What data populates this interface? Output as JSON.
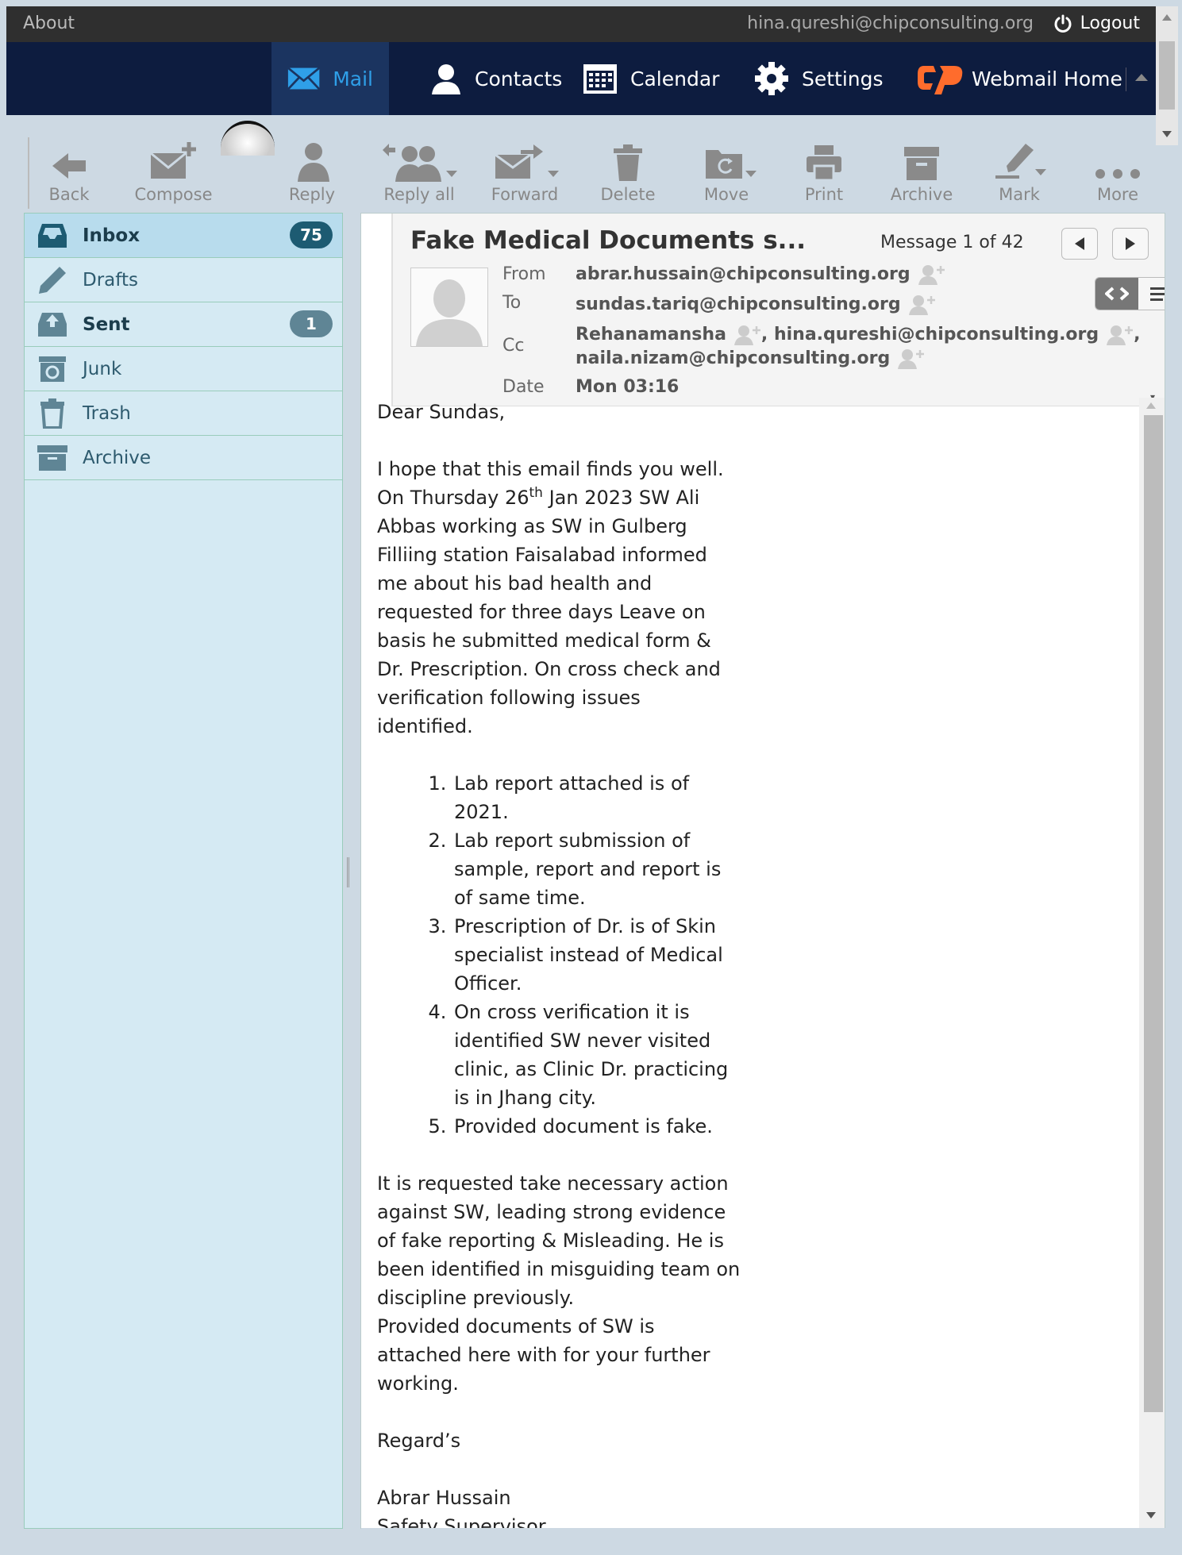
{
  "topbar": {
    "about": "About",
    "user_email": "hina.qureshi@chipconsulting.org",
    "logout": "Logout"
  },
  "nav": {
    "mail": "Mail",
    "contacts": "Contacts",
    "calendar": "Calendar",
    "settings": "Settings",
    "webmail_home": "Webmail Home",
    "active_color": "#2f9fe8",
    "brand_color": "#ff6c2c"
  },
  "toolbar": {
    "back": "Back",
    "compose": "Compose",
    "reply": "Reply",
    "reply_all": "Reply all",
    "forward": "Forward",
    "delete": "Delete",
    "move": "Move",
    "print": "Print",
    "archive": "Archive",
    "mark": "Mark",
    "more": "More"
  },
  "folders": [
    {
      "name": "Inbox",
      "count": "75",
      "icon": "inbox-icon",
      "selected": true
    },
    {
      "name": "Drafts",
      "icon": "pencil-icon"
    },
    {
      "name": "Sent",
      "count": "1",
      "icon": "sent-icon"
    },
    {
      "name": "Junk",
      "icon": "junk-icon"
    },
    {
      "name": "Trash",
      "icon": "trash-icon"
    },
    {
      "name": "Archive",
      "icon": "archive-icon"
    }
  ],
  "message": {
    "subject": "Fake Medical Documents s...",
    "counter": "Message 1 of 42",
    "labels": {
      "from": "From",
      "to": "To",
      "cc": "Cc",
      "date": "Date"
    },
    "from": "abrar.hussain@chipconsulting.org",
    "to": "sundas.tariq@chipconsulting.org",
    "cc1": "Rehanamansha",
    "cc2": "hina.qureshi@chipconsulting.org",
    "cc3": "naila.nizam@chipconsulting.org",
    "date": "Mon 03:16",
    "body": {
      "greeting": "Dear Sundas,",
      "intro": "I hope that this email finds you well.",
      "p1_a": "On Thursday 26",
      "p1_sup": "th",
      "p1_b": " Jan 2023 SW Ali Abbas working as SW in Gulberg Filliing station Faisalabad informed me about his bad health and requested for three days Leave on basis he submitted medical form & Dr. Prescription. On cross check and verification following issues identified.",
      "issues": [
        " Lab report attached is of 2021.",
        " Lab report submission of sample, report and report is of same time.",
        " Prescription of Dr. is of Skin specialist instead of Medical Officer.",
        " On cross verification it is identified SW never visited clinic, as Clinic Dr. practicing is in Jhang city.",
        " Provided document is fake."
      ],
      "p2": "It is requested take necessary action against SW, leading strong evidence of fake reporting & Misleading. He is been identified in misguiding team on discipline previously.",
      "p3": "Provided documents of SW is attached here with for your further working.",
      "regards": "Regard’s",
      "signature": "Abrar Hussain",
      "signature_title": "Safety Supervisor"
    }
  }
}
